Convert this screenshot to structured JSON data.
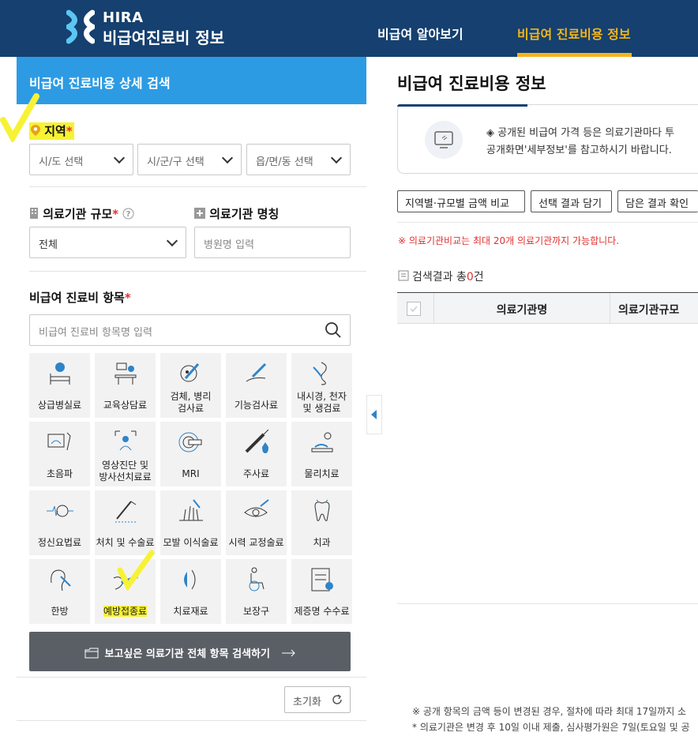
{
  "header": {
    "logo_line1": "HIRA",
    "logo_line2": "비급여진료비 정보",
    "nav": [
      "비급여 알아보기",
      "비급여 진료비용 정보"
    ],
    "active_nav_color": "#f3b51c",
    "background": "#15406f"
  },
  "search_panel": {
    "title": "비급여 진료비용 상세 검색",
    "region": {
      "label": "지역",
      "required_mark": "*",
      "selects": [
        "시/도 선택",
        "시/군/구 선택",
        "읍/면/동 선택"
      ]
    },
    "institution_size": {
      "label": "의료기관 규모",
      "required_mark": "*",
      "help_icon": "question-circle-icon",
      "value": "전체"
    },
    "institution_name": {
      "label": "의료기관 명칭",
      "placeholder": "병원명 입력"
    },
    "item": {
      "label": "비급여 진료비 항목",
      "required_mark": "*",
      "placeholder": "비급여 진료비 항목명 입력"
    },
    "categories": [
      {
        "label": "상급병실료",
        "icon": "hospital-bed-icon"
      },
      {
        "label": "교육상담료",
        "icon": "counseling-icon"
      },
      {
        "label": "검체, 병리\n검사료",
        "icon": "microscope-icon"
      },
      {
        "label": "기능검사료",
        "icon": "function-test-icon"
      },
      {
        "label": "내시경, 천자\n및 생검료",
        "icon": "endoscope-icon"
      },
      {
        "label": "초음파",
        "icon": "ultrasound-icon"
      },
      {
        "label": "영상진단 및\n방사선치료료",
        "icon": "radiology-icon"
      },
      {
        "label": "MRI",
        "icon": "mri-icon"
      },
      {
        "label": "주사료",
        "icon": "syringe-icon"
      },
      {
        "label": "물리치료",
        "icon": "physical-therapy-icon"
      },
      {
        "label": "정신요법료",
        "icon": "brain-icon"
      },
      {
        "label": "처치 및 수술료",
        "icon": "surgery-icon"
      },
      {
        "label": "모발 이식술료",
        "icon": "hair-transplant-icon"
      },
      {
        "label": "시력 교정술료",
        "icon": "eye-icon"
      },
      {
        "label": "치과",
        "icon": "tooth-icon"
      },
      {
        "label": "한방",
        "icon": "acupuncture-icon"
      },
      {
        "label": "예방접종료",
        "icon": "vaccination-icon"
      },
      {
        "label": "치료재료",
        "icon": "treatment-material-icon"
      },
      {
        "label": "보장구",
        "icon": "wheelchair-icon"
      },
      {
        "label": "제증명 수수료",
        "icon": "certificate-icon"
      }
    ],
    "full_search_button": "보고싶은 의료기관 전체 항목 검색하기",
    "reset_button": "초기화",
    "accent_color": "#2d9be3",
    "highlight_color": "#f7f235"
  },
  "results": {
    "title": "비급여 진료비용 정보",
    "notice_line1": "◈ 공개된 비급여 가격 등은 의료기관마다 투",
    "notice_line2": "공개화면'세부정보'를 참고하시기 바랍니다.",
    "buttons": [
      "지역별·규모별 금액 비교",
      "선택 결과 담기",
      "담은 결과 확인"
    ],
    "warning": "※ 의료기관비교는 최대 20개 의료기관까지 가능합니다.",
    "count_prefix": "검색결과 총",
    "count_value": "0",
    "count_suffix": "건",
    "columns": [
      "의료기관명",
      "의료기관규모"
    ],
    "footnote1": "※ 공개 항목의 금액 등이 변경된 경우, 절차에 따라 최대 17일까지 소",
    "footnote2": "* 의료기관은 변경 후 10일 이내 제출, 심사평가원은 7일(토요일 및 공"
  }
}
